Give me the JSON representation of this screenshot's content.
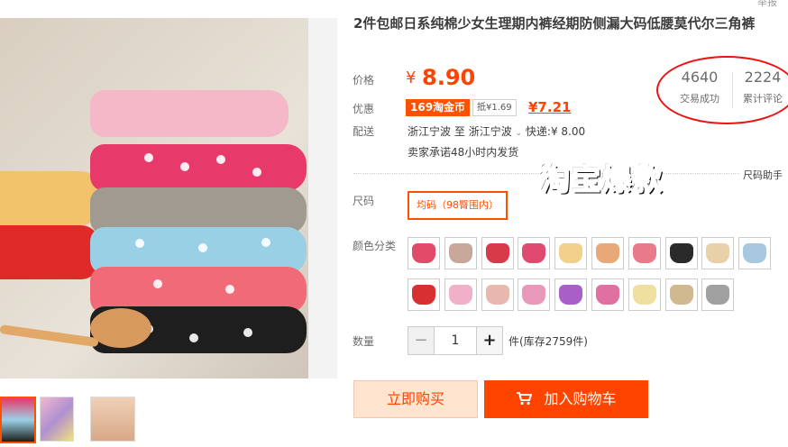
{
  "product": {
    "title": "2件包邮日系纯棉少女生理期内裤经期防侧漏大码低腰莫代尔三角裤"
  },
  "price": {
    "label": "价格",
    "symbol": "¥",
    "value": "8.90"
  },
  "promo": {
    "label": "优惠",
    "tag": "169淘金币",
    "deduct": "抵¥1.69",
    "price": "¥7.21"
  },
  "shipping": {
    "label": "配送",
    "from": "浙江宁波",
    "to_word": "至",
    "to": "浙江宁波",
    "express": "快递:¥ 8.00",
    "promise": "卖家承诺48小时内发货"
  },
  "stats": {
    "sales_count": "4640",
    "sales_label": "交易成功",
    "review_count": "2224",
    "review_label": "累计评论"
  },
  "size_helper": "尺码助手",
  "banner": "淘宝爆款",
  "size": {
    "label": "尺码",
    "option": "均码（98臀围内）"
  },
  "colors": {
    "label": "颜色分类",
    "swatches": [
      "#e04b6a",
      "#c7a79a",
      "#d83a4a",
      "#e04a70",
      "#f0d08a",
      "#e8a878",
      "#e87a8a",
      "#2a2a2a",
      "#e8d0a8",
      "#a8c8e0",
      "#d83030",
      "#f0b0c8",
      "#e8b8b0",
      "#e898b8",
      "#a860c8",
      "#e070a0",
      "#f0e0a0",
      "#d0b890",
      "#a0a0a0"
    ]
  },
  "quantity": {
    "label": "数量",
    "minus": "−",
    "value": "1",
    "plus": "+",
    "stock": "件(库存2759件)"
  },
  "actions": {
    "buy_now": "立即购买",
    "cart_icon": "cart-icon",
    "add_to_cart": "加入购物车"
  },
  "top_right": "举报",
  "colors_theme": {
    "accent": "#ff5000",
    "price": "#ff4400",
    "annotation": "#ee1111"
  }
}
